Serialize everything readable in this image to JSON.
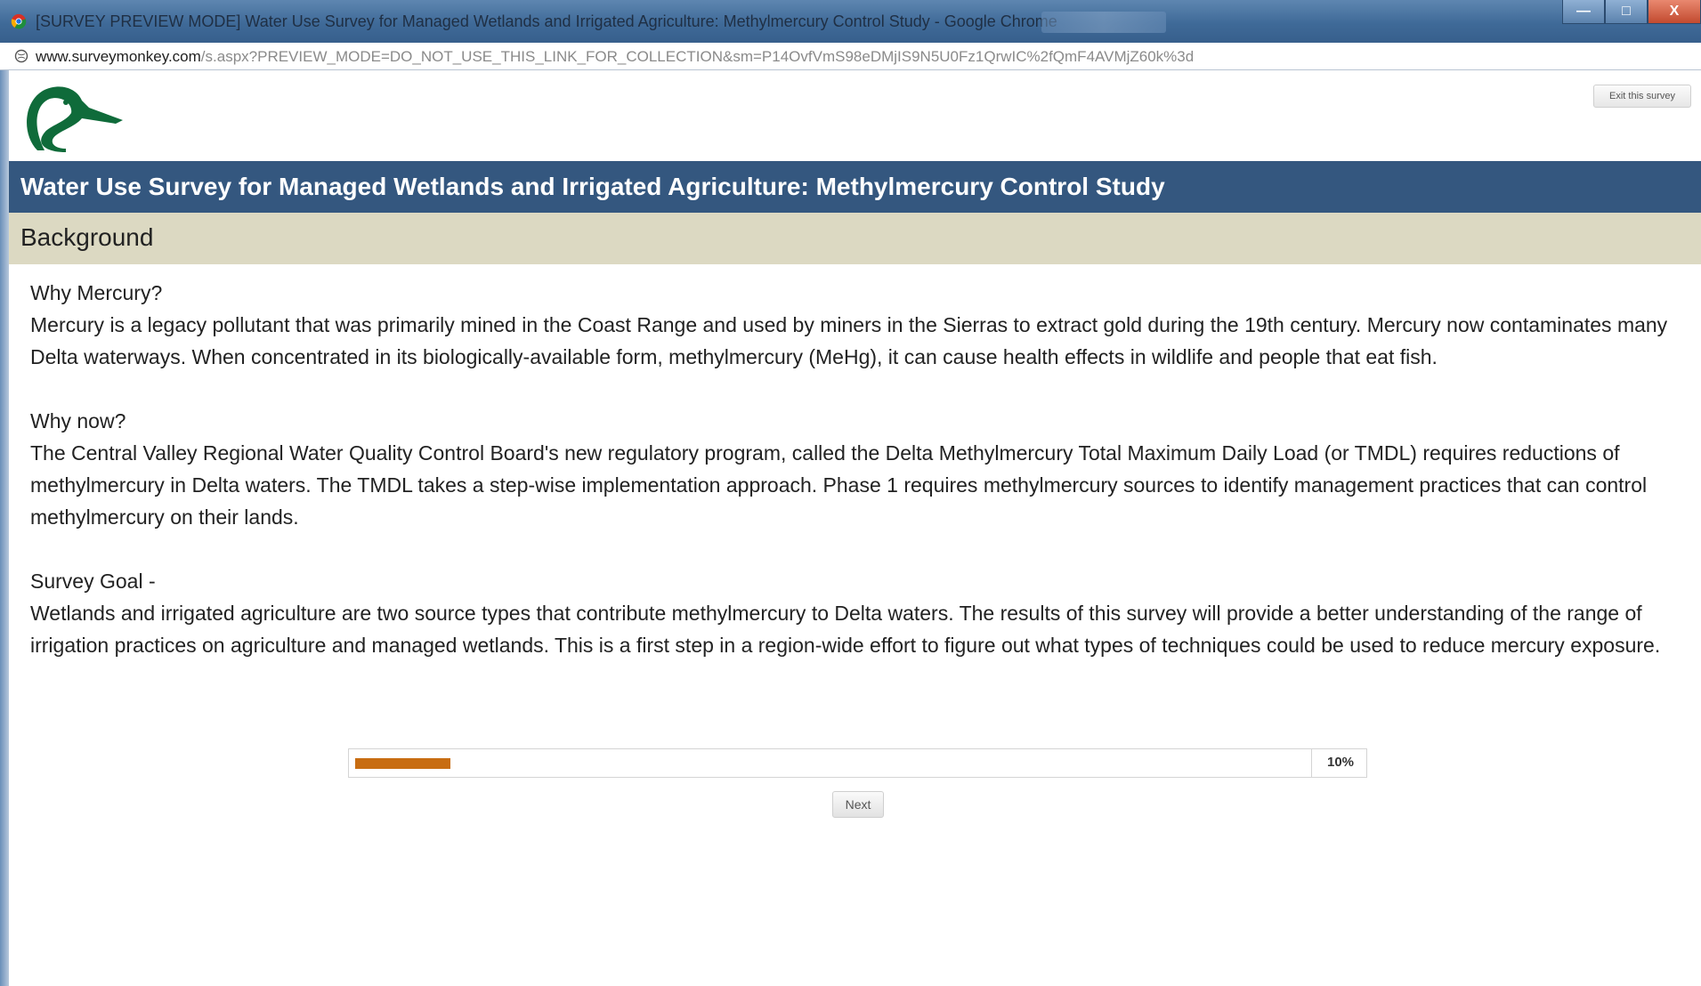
{
  "browser": {
    "window_title": "[SURVEY PREVIEW MODE] Water Use Survey for Managed Wetlands and Irrigated Agriculture: Methylmercury Control Study - Google Chrome",
    "url_host": "www.surveymonkey.com",
    "url_path": "/s.aspx?PREVIEW_MODE=DO_NOT_USE_THIS_LINK_FOR_COLLECTION&sm=P14OvfVmS98eDMjIS9N5U0Fz1QrwIC%2fQmF4AVMjZ60k%3d",
    "controls": {
      "minimize": "—",
      "maximize": "□",
      "close": "X"
    }
  },
  "header": {
    "logo_icon": "duck-head-logo",
    "exit_label": "Exit this survey"
  },
  "survey": {
    "title": "Water Use Survey for Managed Wetlands and Irrigated Agriculture: Methylmercury Control Study",
    "page_heading": "Background"
  },
  "sections": [
    {
      "heading": "Why Mercury?",
      "body": "Mercury is a legacy pollutant that was primarily mined in the Coast Range and used by miners in the Sierras to extract gold during the 19th century. Mercury now contaminates many Delta waterways. When concentrated in its biologically-available form, methylmercury (MeHg), it can cause health effects in wildlife and people that eat fish."
    },
    {
      "heading": "Why now?",
      "body": "The Central Valley Regional Water Quality Control Board's new regulatory program, called the Delta Methylmercury Total Maximum Daily Load (or TMDL) requires reductions of methylmercury in Delta waters. The TMDL takes a step-wise implementation approach. Phase 1 requires methylmercury sources to identify management practices that can control methylmercury on their lands."
    },
    {
      "heading": "Survey Goal -",
      "body": "Wetlands and irrigated agriculture are two source types that contribute methylmercury to Delta waters. The results of this survey will provide a better understanding of the range of irrigation practices on agriculture and managed wetlands. This is a first step in a region-wide effort to figure out what types of techniques could be used to reduce mercury exposure."
    }
  ],
  "progress": {
    "percent": 10,
    "label": "10%",
    "fill_color": "#c86d12"
  },
  "navigation": {
    "next_label": "Next"
  },
  "colors": {
    "title_bar": "#34577f",
    "heading_bar": "#dcd9c2",
    "logo_green": "#0f6b3a"
  }
}
